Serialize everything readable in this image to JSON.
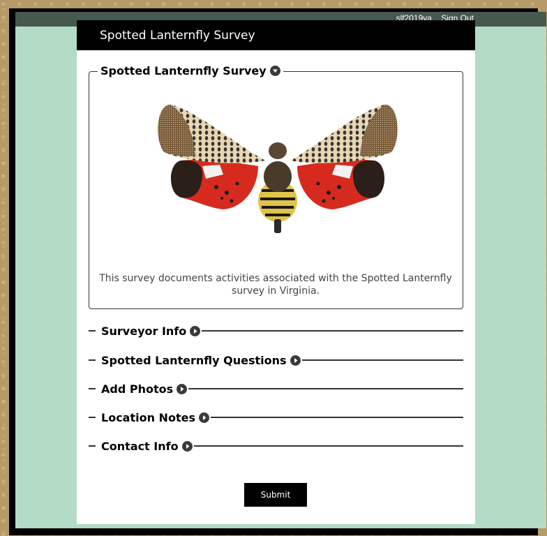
{
  "user": {
    "name": "slf2019va",
    "sign_out": "Sign Out"
  },
  "header": {
    "title": "Spotted Lanternfly Survey"
  },
  "intro_group": {
    "legend": "Spotted Lanternfly Survey",
    "description": "This survey documents activities associated with the Spotted Lanternfly survey in Virginia."
  },
  "sections": [
    {
      "label": "Surveyor Info"
    },
    {
      "label": "Spotted Lanternfly Questions"
    },
    {
      "label": "Add Photos"
    },
    {
      "label": "Location Notes"
    },
    {
      "label": "Contact Info"
    }
  ],
  "submit_label": "Submit",
  "colors": {
    "header": "#000000",
    "background": "#b3dbc6",
    "topbar": "#47584f"
  },
  "icons": {
    "expanded": "chevron-down-icon",
    "collapsed": "chevron-right-icon"
  }
}
